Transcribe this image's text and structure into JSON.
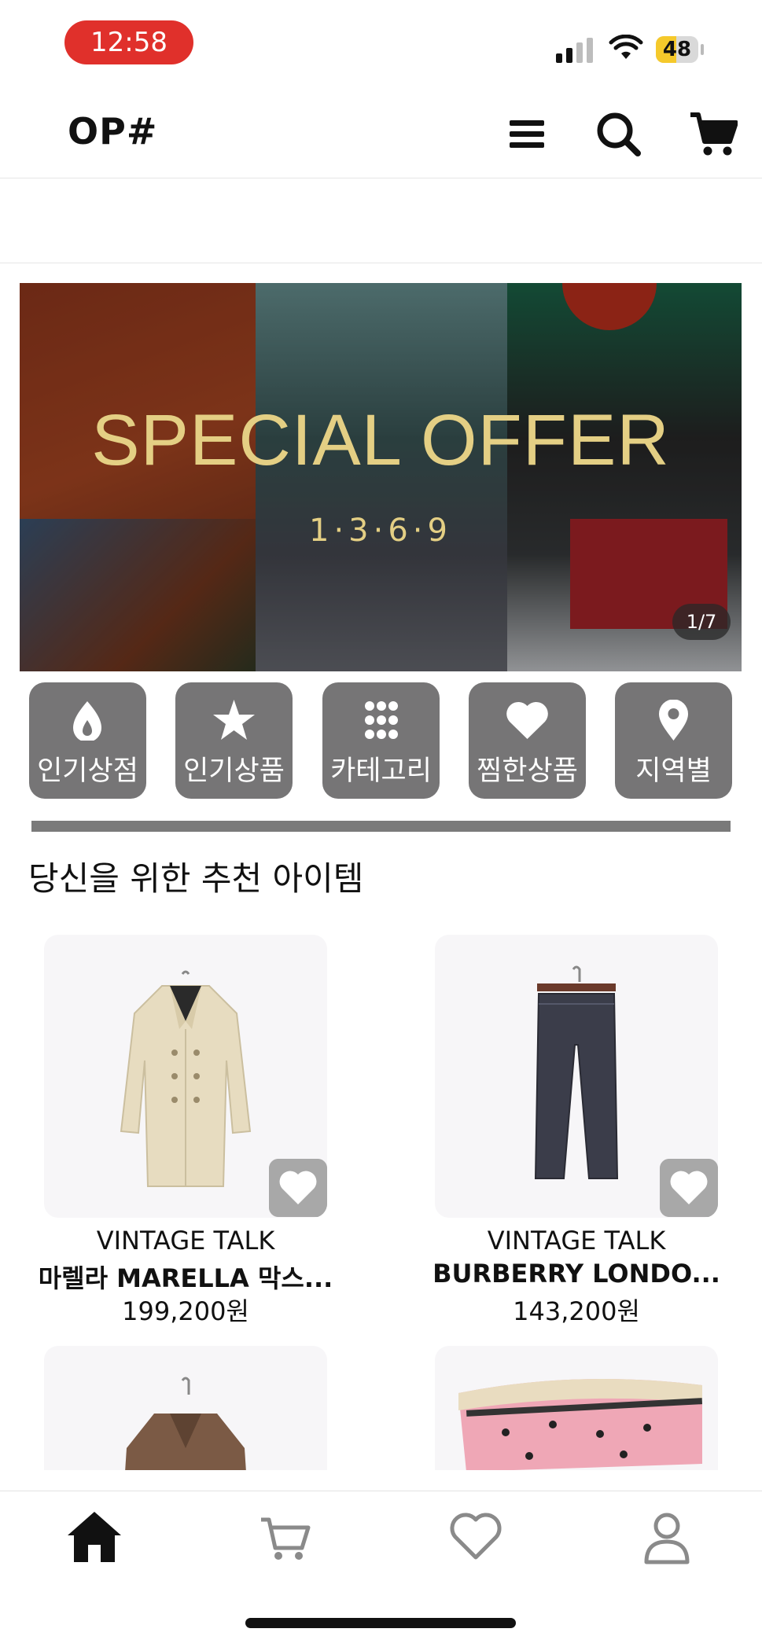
{
  "status_bar": {
    "time": "12:58",
    "battery": "48",
    "battery_level": 0.48,
    "time_pill_color": "#e0302b"
  },
  "header": {
    "logo": "OP#",
    "icons": [
      "menu-icon",
      "search-icon",
      "cart-icon"
    ]
  },
  "banner": {
    "title": "SPECIAL OFFER",
    "subtitle": "1·3·6·9",
    "counter": "1/7",
    "title_color": "#e4cf84"
  },
  "quick_menu": [
    {
      "icon": "fire-icon",
      "label": "인기상점"
    },
    {
      "icon": "star-icon",
      "label": "인기상품"
    },
    {
      "icon": "grid-icon",
      "label": "카테고리"
    },
    {
      "icon": "heart-icon",
      "label": "찜한상품"
    },
    {
      "icon": "location-pin-icon",
      "label": "지역별"
    }
  ],
  "section": {
    "title": "당신을 위한 추천 아이템"
  },
  "products": [
    {
      "brand": "VINTAGE TALK",
      "name": "마렐라 MARELLA 막스...",
      "price": "199,200원"
    },
    {
      "brand": "VINTAGE TALK",
      "name": "BURBERRY LONDO...",
      "price": "143,200원"
    }
  ],
  "bottom_nav": [
    {
      "icon": "home-icon",
      "active": true
    },
    {
      "icon": "cart-icon",
      "active": false
    },
    {
      "icon": "heart-icon",
      "active": false
    },
    {
      "icon": "profile-icon",
      "active": false
    }
  ],
  "colors": {
    "quick_menu_bg": "#767576",
    "accent_dark": "#111111"
  }
}
